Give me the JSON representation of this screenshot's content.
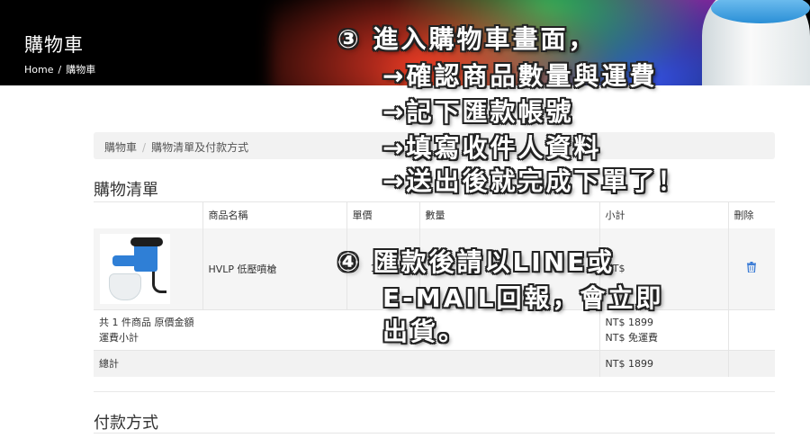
{
  "header": {
    "title": "購物車",
    "breadcrumb": [
      "Home",
      "購物車"
    ],
    "separator": "/"
  },
  "breadcrumb_bar": {
    "items": [
      "購物車",
      "購物清單及付款方式"
    ],
    "separator": "/"
  },
  "cart": {
    "section_title": "購物清單",
    "columns": [
      "商品名稱",
      "單價",
      "數量",
      "小計",
      "刪除"
    ],
    "items": [
      {
        "name": "HVLP 低壓噴槍",
        "unit_price": "18",
        "quantity": "",
        "subtotal": "NT$",
        "delete_icon": "trash-icon"
      }
    ],
    "summary": {
      "count_label": "共 1 件商品 原價金額",
      "shipping_label": "運費小計",
      "original_total": "NT$ 1899",
      "shipping_value": "NT$ 免運費"
    },
    "total_label": "總計",
    "total_value": "NT$ 1899"
  },
  "payment": {
    "section_title": "付款方式"
  },
  "annotations": {
    "step3": [
      "③ 進入購物車畫面，",
      "→確認商品數量與運費",
      "→記下匯款帳號",
      "→填寫收件人資料",
      "→送出後就完成下單了！"
    ],
    "step4": [
      "④ 匯款後請以LINE或",
      "E-MAIL回報，會立即",
      "出貨。"
    ]
  },
  "colors": {
    "banner_bg": "#000000",
    "accent_icon": "#3a7bd5",
    "row_bg": "#f5f5f5"
  }
}
